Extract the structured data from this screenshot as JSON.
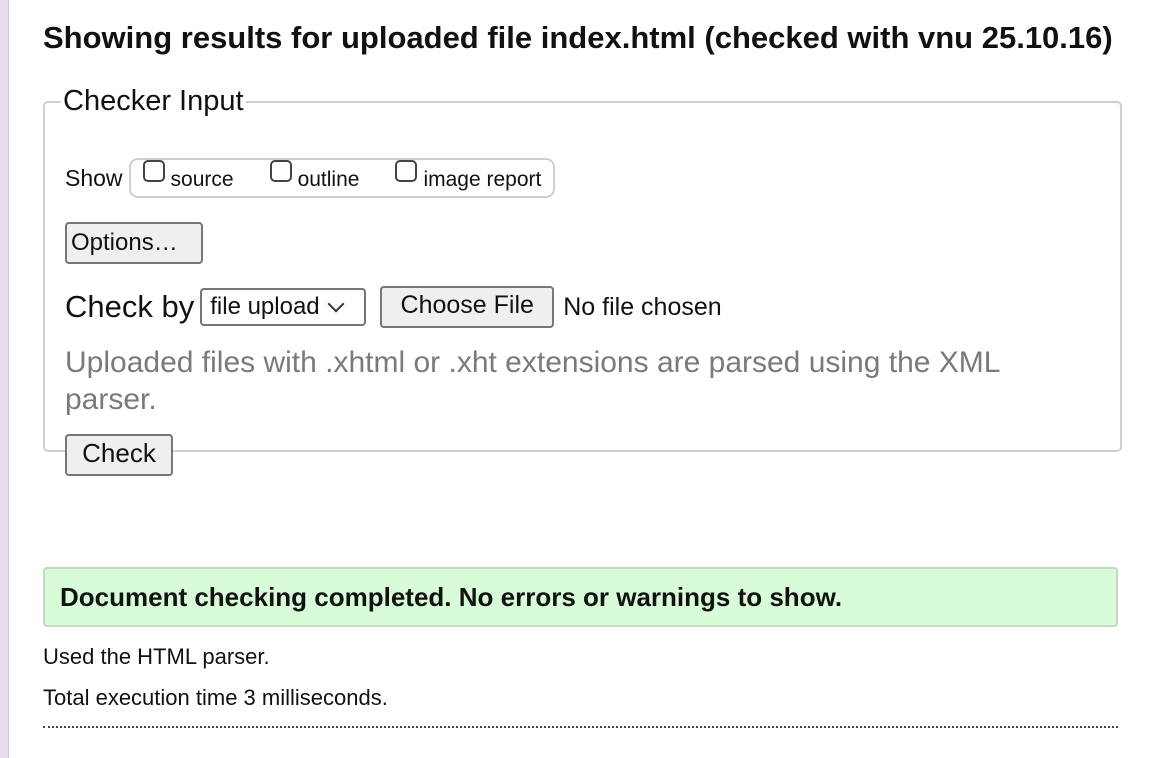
{
  "header": {
    "title": "Showing results for uploaded file index.html (checked with vnu 25.10.16)"
  },
  "checker_input": {
    "legend": "Checker Input",
    "show_label": "Show",
    "show_options": [
      {
        "label": "source",
        "checked": false
      },
      {
        "label": "outline",
        "checked": false
      },
      {
        "label": "image report",
        "checked": false
      }
    ],
    "options_button": "Options…",
    "check_by_label": "Check by",
    "check_by_selected": "file upload",
    "choose_file_button": "Choose File",
    "file_status": "No file chosen",
    "hint": "Uploaded files with .xhtml or .xht extensions are parsed using the XML parser.",
    "check_button": "Check"
  },
  "results": {
    "success_message": "Document checking completed. No errors or warnings to show.",
    "parser_note": "Used the HTML parser.",
    "execution_time": "Total execution time 3 milliseconds."
  },
  "colors": {
    "success_bg": "#d8fcd8",
    "hint_text": "#7a7a7a",
    "left_strip": "#e9dcee"
  }
}
